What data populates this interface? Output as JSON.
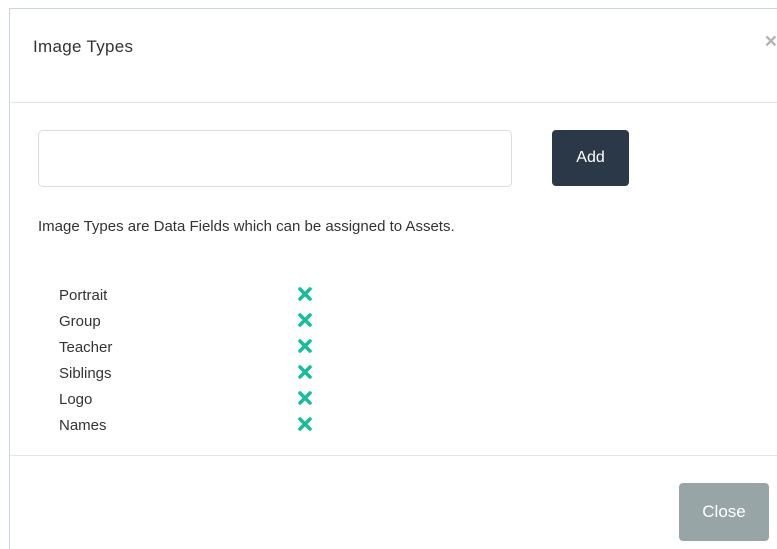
{
  "modal": {
    "title": "Image Types",
    "close_glyph": "×",
    "input": {
      "value": "",
      "placeholder": ""
    },
    "add_label": "Add",
    "help_text": "Image Types are Data Fields which can be assigned to Assets.",
    "image_types": [
      {
        "name": "Portrait"
      },
      {
        "name": "Group"
      },
      {
        "name": "Teacher"
      },
      {
        "name": "Siblings"
      },
      {
        "name": "Logo"
      },
      {
        "name": "Names"
      }
    ],
    "close_label": "Close"
  },
  "colors": {
    "accent_remove": "#1abc9c",
    "add_button_bg": "#2b3847",
    "close_button_bg": "#98a5a6"
  },
  "icons": {
    "header_close": "close-icon",
    "row_remove": "remove-icon"
  }
}
